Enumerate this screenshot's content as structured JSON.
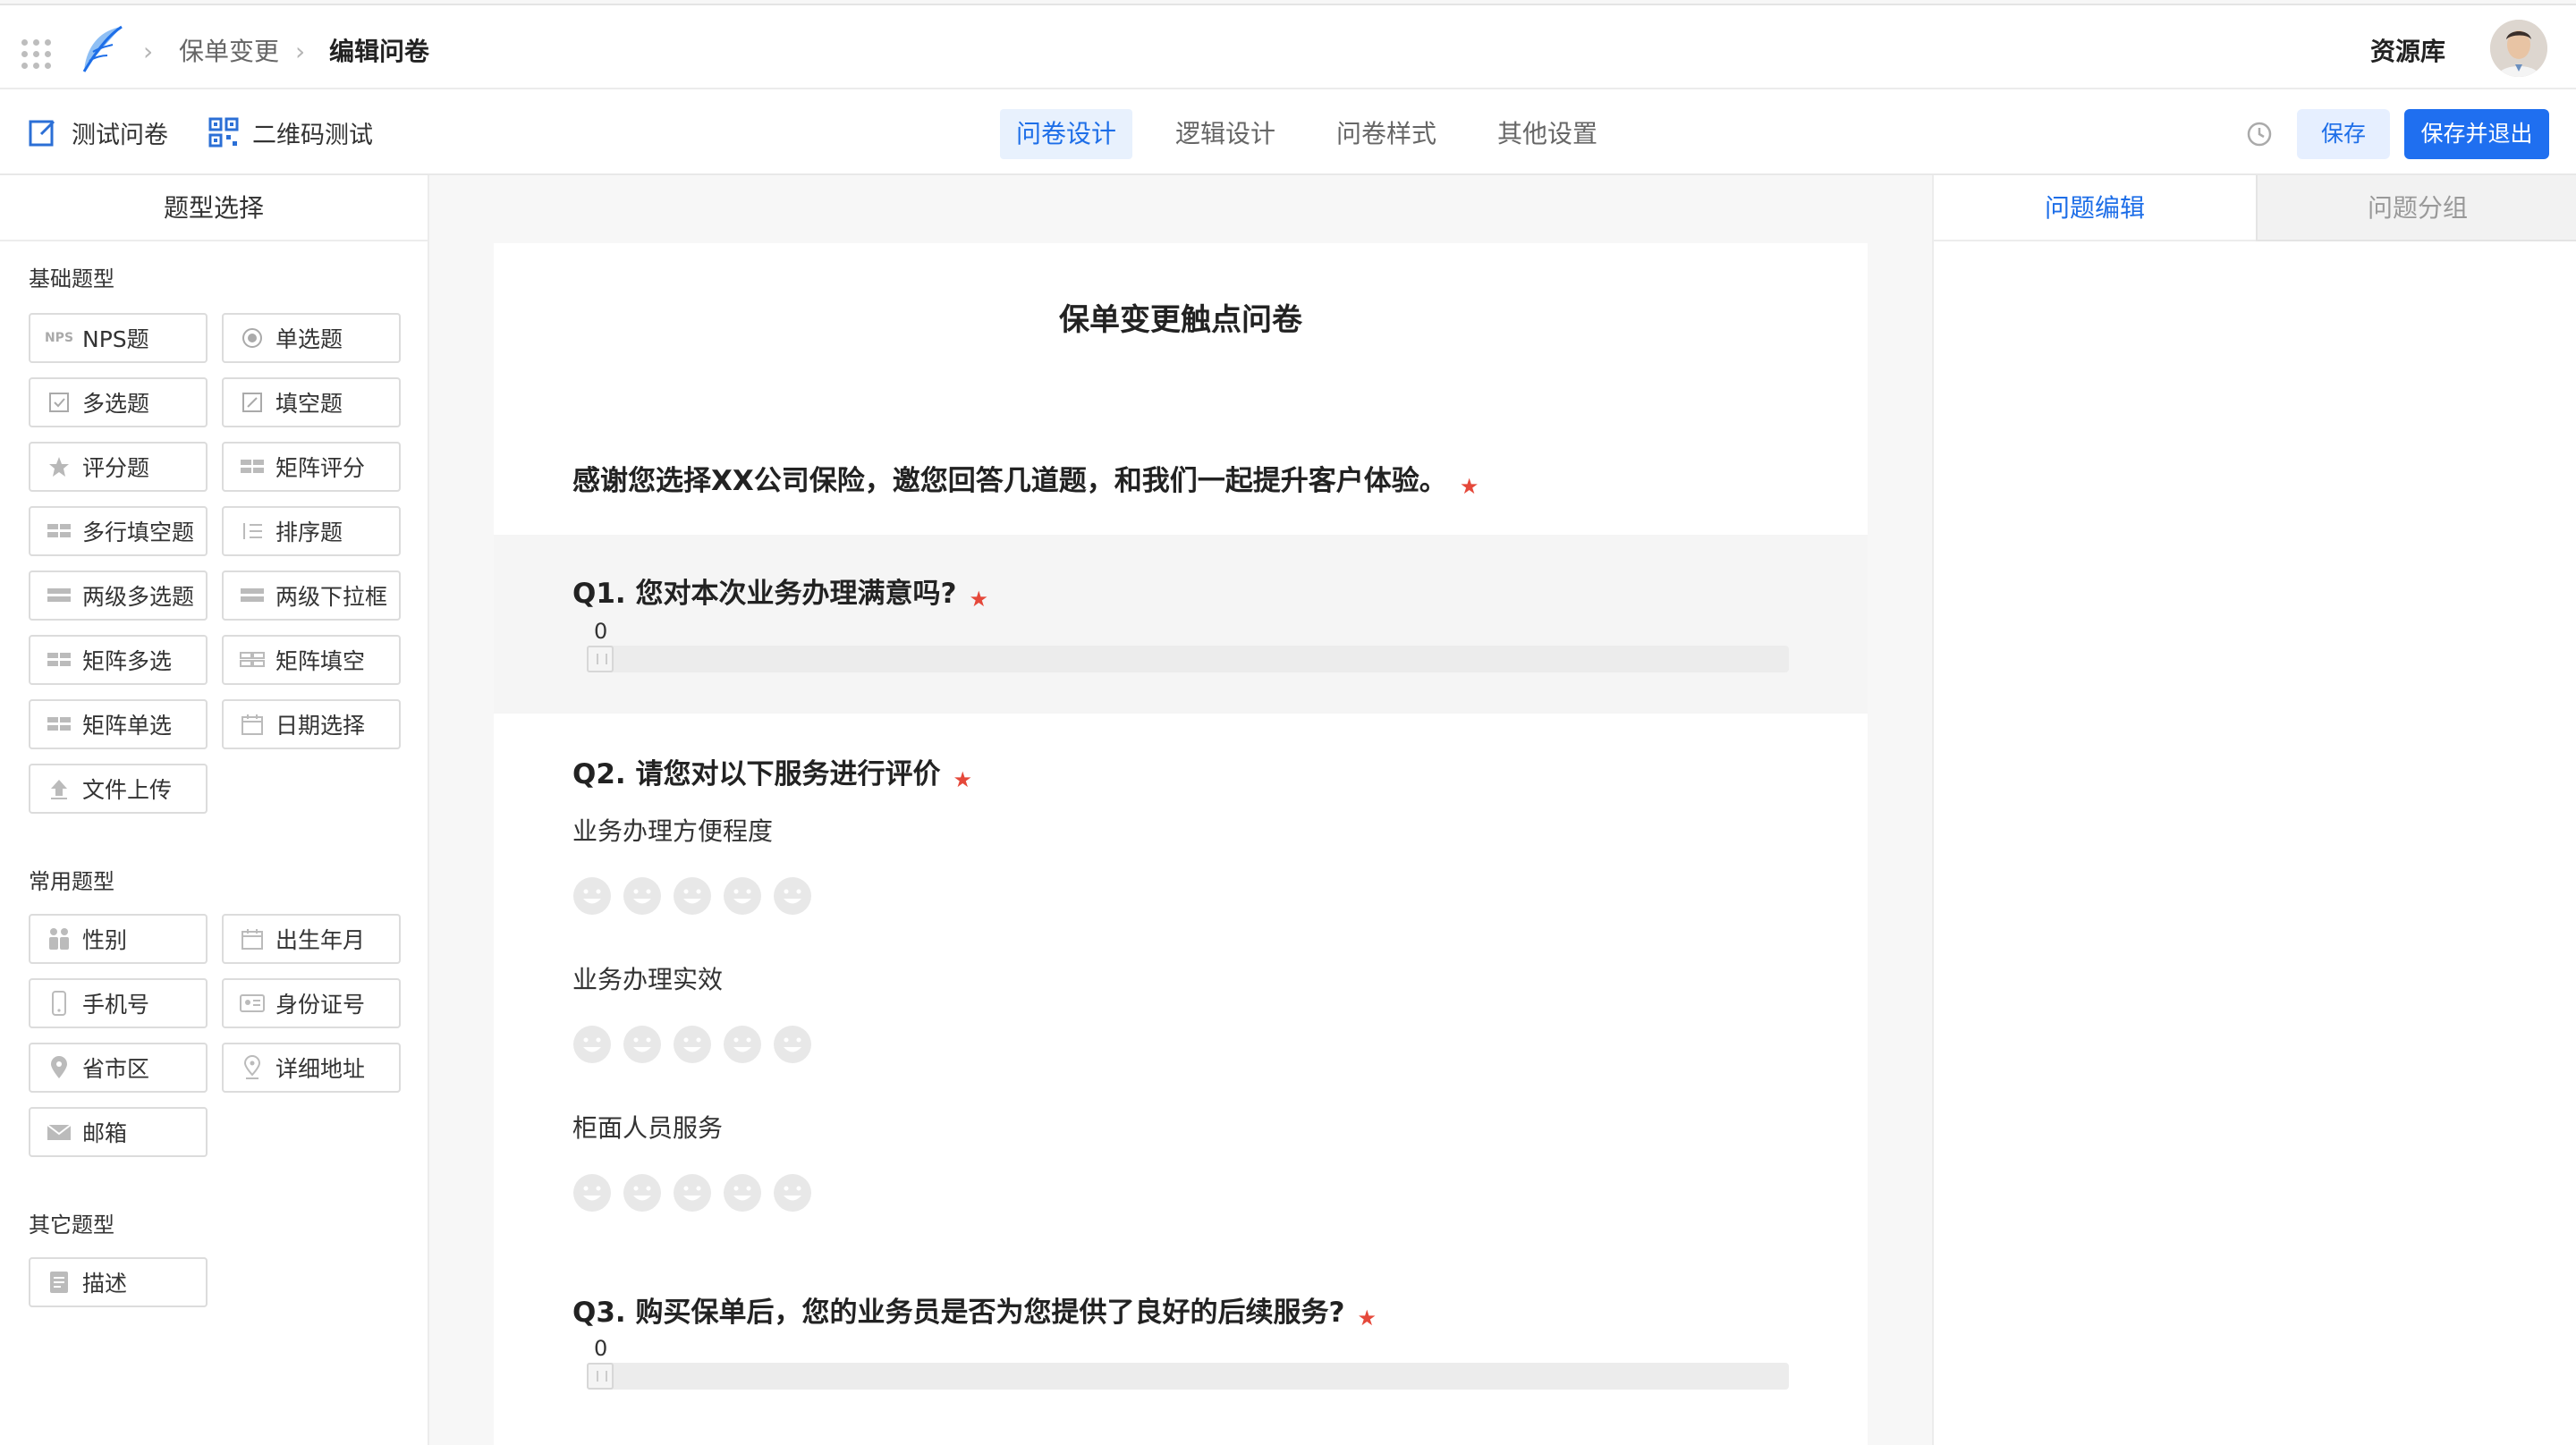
{
  "header": {
    "breadcrumbs": [
      "保单变更",
      "编辑问卷"
    ],
    "resource_library": "资源库"
  },
  "toolbar": {
    "test_survey": "测试问卷",
    "qr_test": "二维码测试",
    "tabs": [
      "问卷设计",
      "逻辑设计",
      "问卷样式",
      "其他设置"
    ],
    "active_tab": "问卷设计",
    "save": "保存",
    "save_exit": "保存并退出"
  },
  "left_panel": {
    "title": "题型选择",
    "groups": [
      {
        "title": "基础题型",
        "items": [
          {
            "label": "NPS题",
            "icon": "nps-icon"
          },
          {
            "label": "单选题",
            "icon": "radio-icon"
          },
          {
            "label": "多选题",
            "icon": "checkbox-icon"
          },
          {
            "label": "填空题",
            "icon": "edit-icon"
          },
          {
            "label": "评分题",
            "icon": "star-icon"
          },
          {
            "label": "矩阵评分",
            "icon": "matrix-icon"
          },
          {
            "label": "多行填空题",
            "icon": "matrix-icon"
          },
          {
            "label": "排序题",
            "icon": "sort-icon"
          },
          {
            "label": "两级多选题",
            "icon": "list-icon"
          },
          {
            "label": "两级下拉框",
            "icon": "dropdown-icon"
          },
          {
            "label": "矩阵多选",
            "icon": "matrix-icon"
          },
          {
            "label": "矩阵填空",
            "icon": "matrix-icon"
          },
          {
            "label": "矩阵单选",
            "icon": "matrix-icon"
          },
          {
            "label": "日期选择",
            "icon": "calendar-icon"
          },
          {
            "label": "文件上传",
            "icon": "upload-icon"
          }
        ]
      },
      {
        "title": "常用题型",
        "items": [
          {
            "label": "性别",
            "icon": "gender-icon"
          },
          {
            "label": "出生年月",
            "icon": "calendar-icon"
          },
          {
            "label": "手机号",
            "icon": "phone-icon"
          },
          {
            "label": "身份证号",
            "icon": "id-card-icon"
          },
          {
            "label": "省市区",
            "icon": "location-icon"
          },
          {
            "label": "详细地址",
            "icon": "location-icon"
          },
          {
            "label": "邮箱",
            "icon": "mail-icon"
          }
        ]
      },
      {
        "title": "其它题型",
        "items": [
          {
            "label": "描述",
            "icon": "document-icon"
          }
        ]
      }
    ]
  },
  "survey": {
    "title": "保单变更触点问卷",
    "intro": "感谢您选择XX公司保险，邀您回答几道题，和我们一起提升客户体验。",
    "required_mark": "★",
    "q1": {
      "text": "Q1. 您对本次业务办理满意吗?",
      "slider_value": "0",
      "slider_fraction": 0
    },
    "q2": {
      "text": "Q2. 请您对以下服务进行评价",
      "items": [
        "业务办理方便程度",
        "业务办理实效",
        "柜面人员服务"
      ]
    },
    "q3": {
      "text": "Q3. 购买保单后，您的业务员是否为您提供了良好的后续服务?",
      "slider_value": "0",
      "slider_fraction": 0
    }
  },
  "right_panel": {
    "tabs": [
      "问题编辑",
      "问题分组"
    ],
    "active_tab": "问题编辑"
  },
  "colors": {
    "accent": "#1d6ee8",
    "required": "#e5483a",
    "active_tab_bg": "#e8f1fd"
  }
}
